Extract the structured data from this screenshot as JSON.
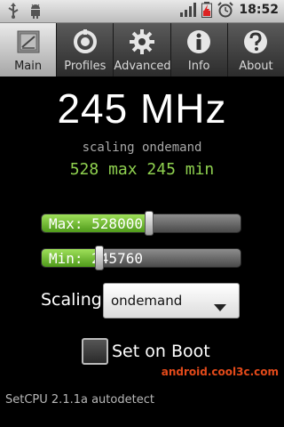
{
  "status_bar": {
    "time": "18:52",
    "icons": [
      "usb-icon",
      "android-debug-icon",
      "signal-icon",
      "battery-icon",
      "alarm-icon"
    ]
  },
  "tabs": [
    {
      "label": "Main",
      "icon": "cpu-chip-icon",
      "active": true
    },
    {
      "label": "Profiles",
      "icon": "profile-ring-icon",
      "active": false
    },
    {
      "label": "Advanced",
      "icon": "gear-icon",
      "active": false
    },
    {
      "label": "Info",
      "icon": "info-icon",
      "active": false
    },
    {
      "label": "About",
      "icon": "question-icon",
      "active": false
    }
  ],
  "main": {
    "frequency": "245 MHz",
    "scaling_text": "scaling ondemand",
    "maxmin_text": "528 max 245 min"
  },
  "sliders": {
    "max": {
      "text": "Max: 528000",
      "fraction": 0.54
    },
    "min": {
      "text": "Min: 245760",
      "fraction": 0.29
    }
  },
  "scaling": {
    "label": "Scaling",
    "selected": "ondemand"
  },
  "boot": {
    "label": "Set on Boot",
    "checked": false
  },
  "watermark": "android.cool3c.com",
  "footer": "SetCPU 2.1.1a autodetect",
  "colors": {
    "accent_green": "#8fd14f",
    "slider_fill": "#6cc02a",
    "watermark": "#e34a1a"
  }
}
